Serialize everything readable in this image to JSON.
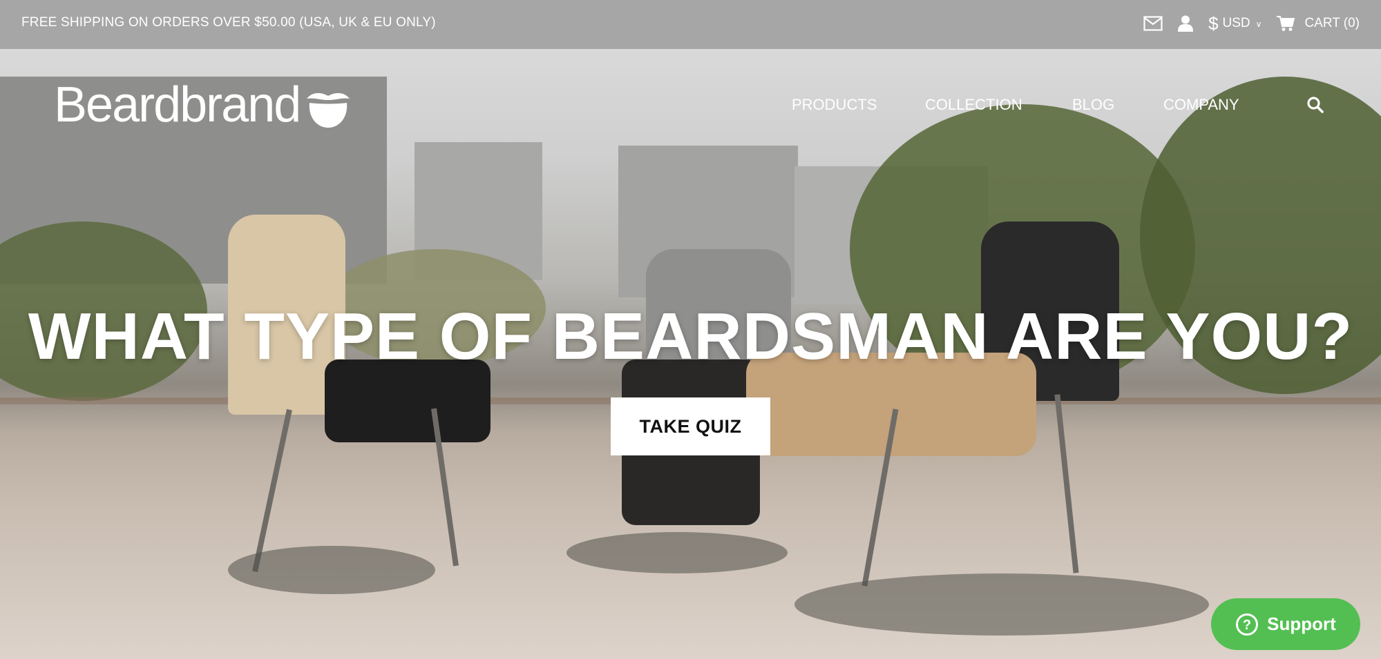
{
  "topbar": {
    "promo": "FREE SHIPPING ON ORDERS OVER $50.00 (USA, UK & EU ONLY)",
    "currency_symbol": "$",
    "currency": "USD",
    "cart_label": "CART (0)",
    "icons": [
      "envelope-icon",
      "user-icon",
      "chevron-down-icon",
      "cart-icon"
    ]
  },
  "header": {
    "logo": "Beardbrand",
    "nav": [
      {
        "label": "PRODUCTS"
      },
      {
        "label": "COLLECTION"
      },
      {
        "label": "BLOG"
      },
      {
        "label": "COMPANY"
      }
    ]
  },
  "hero": {
    "headline": "WHAT TYPE OF BEARDSMAN ARE YOU?",
    "cta_label": "TAKE QUIZ"
  },
  "support": {
    "label": "Support",
    "color": "#53bf52"
  },
  "colors": {
    "topbar_bg": "#a6a6a6"
  }
}
